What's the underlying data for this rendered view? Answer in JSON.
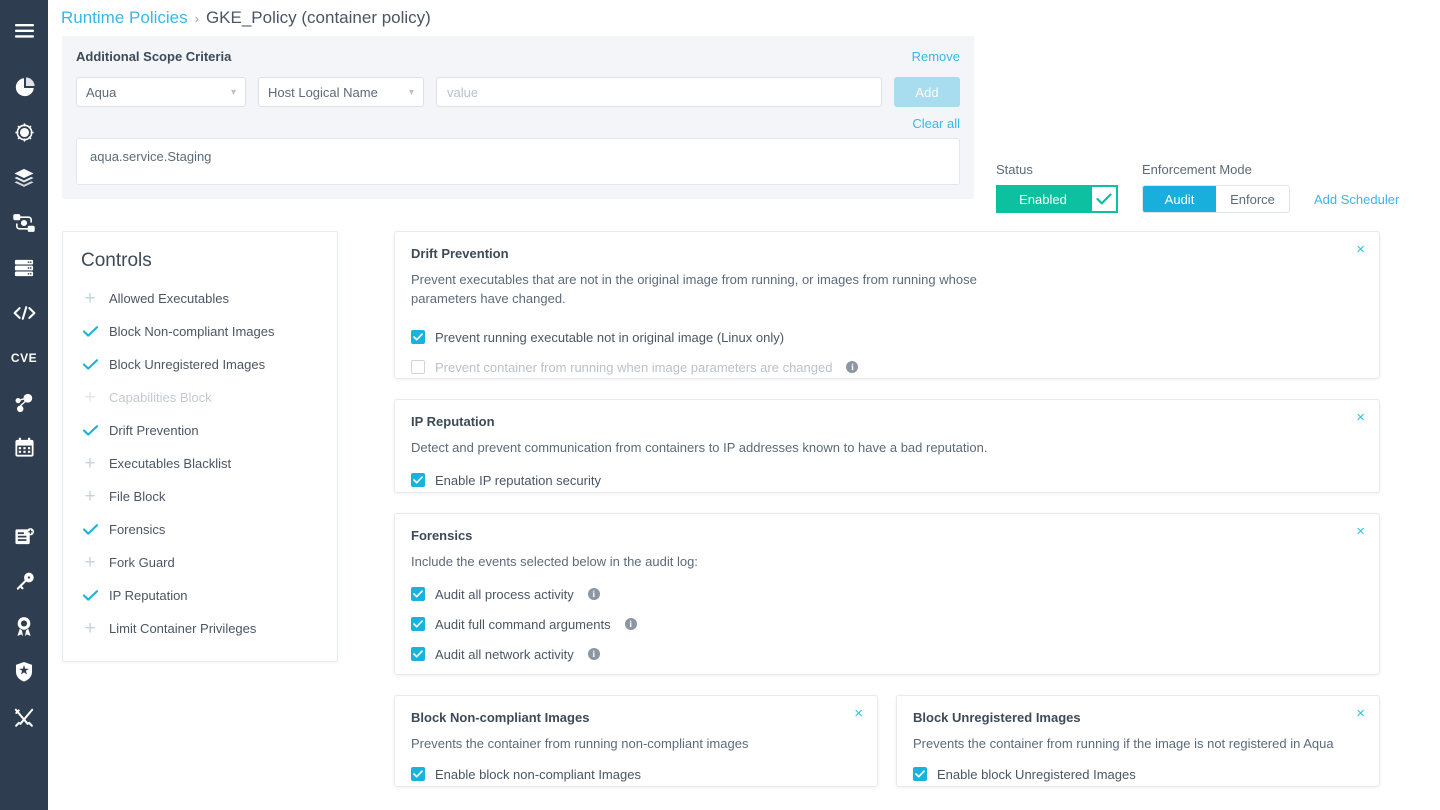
{
  "rail": {
    "items": [
      {
        "name": "hamburger-menu-icon",
        "label": "Menu"
      },
      {
        "name": "dashboard-pie-icon",
        "label": "Dashboard"
      },
      {
        "name": "helm-settings-icon",
        "label": "Workloads"
      },
      {
        "name": "layers-icon",
        "label": "Images"
      },
      {
        "name": "pipeline-icon",
        "label": "Pipeline"
      },
      {
        "name": "server-icon",
        "label": "Infrastructure"
      },
      {
        "name": "code-icon",
        "label": "Code"
      },
      {
        "name": "cve-icon",
        "label": "CVE"
      },
      {
        "name": "topology-icon",
        "label": "Topology"
      },
      {
        "name": "calendar-icon",
        "label": "Scheduler"
      },
      {
        "name": "report-icon",
        "label": "Reports"
      },
      {
        "name": "key-icon",
        "label": "Secrets"
      },
      {
        "name": "badge-icon",
        "label": "Compliance"
      },
      {
        "name": "shield-star-icon",
        "label": "Policies"
      },
      {
        "name": "tools-icon",
        "label": "Administration"
      }
    ],
    "cve_text": "CVE"
  },
  "breadcrumb": {
    "parent": "Runtime Policies",
    "separator": "›",
    "current": "GKE_Policy (container policy)"
  },
  "scope": {
    "title": "Additional Scope Criteria",
    "remove_label": "Remove",
    "clear_all_label": "Clear all",
    "source_select": "Aqua",
    "attribute_select": "Host Logical Name",
    "value_placeholder": "value",
    "value_text": "",
    "add_label": "Add",
    "tag_value": "aqua.service.Staging"
  },
  "status": {
    "status_label": "Status",
    "enabled_label": "Enabled",
    "enforcement_label": "Enforcement Mode",
    "audit_label": "Audit",
    "enforce_label": "Enforce",
    "active_mode": "Audit",
    "add_scheduler_label": "Add Scheduler"
  },
  "controls": {
    "title": "Controls",
    "items": [
      {
        "label": "Allowed Executables",
        "state": "plus",
        "dim": false
      },
      {
        "label": "Block Non-compliant Images",
        "state": "check",
        "dim": false
      },
      {
        "label": "Block Unregistered Images",
        "state": "check",
        "dim": false
      },
      {
        "label": "Capabilities Block",
        "state": "plus",
        "dim": true
      },
      {
        "label": "Drift Prevention",
        "state": "check",
        "dim": false
      },
      {
        "label": "Executables Blacklist",
        "state": "plus",
        "dim": false
      },
      {
        "label": "File Block",
        "state": "plus",
        "dim": false
      },
      {
        "label": "Forensics",
        "state": "check",
        "dim": false
      },
      {
        "label": "Fork Guard",
        "state": "plus",
        "dim": false
      },
      {
        "label": "IP Reputation",
        "state": "check",
        "dim": false
      },
      {
        "label": "Limit Container Privileges",
        "state": "plus",
        "dim": false
      }
    ]
  },
  "cards": {
    "drift": {
      "title": "Drift Prevention",
      "desc": "Prevent executables that are not in the original image from running, or images from running whose parameters have changed.",
      "close": "×",
      "opt1": "Prevent running executable not in original image (Linux only)",
      "opt2": "Prevent container from running when image parameters are changed",
      "info": "i"
    },
    "ip": {
      "title": "IP Reputation",
      "desc": "Detect and prevent communication from containers to IP addresses known to have a bad reputation.",
      "close": "×",
      "opt1": "Enable IP reputation security"
    },
    "forensics": {
      "title": "Forensics",
      "desc": "Include the events selected below in the audit log:",
      "close": "×",
      "opt1": "Audit all process activity",
      "opt2": "Audit full command arguments",
      "opt3": "Audit all network activity",
      "info": "i"
    },
    "noncompliant": {
      "title": "Block Non-compliant Images",
      "desc": "Prevents the container from running non-compliant images",
      "close": "×",
      "opt1": "Enable block non-compliant Images"
    },
    "unregistered": {
      "title": "Block Unregistered Images",
      "desc": "Prevents the container from running if the image is not registered in Aqua",
      "close": "×",
      "opt1": "Enable block Unregistered Images"
    }
  },
  "colors": {
    "rail_bg": "#2e3e50",
    "link": "#35b9e6",
    "checkbox_on": "#17b3dd",
    "enabled_green": "#0cc0a0",
    "segment_active": "#18afdc",
    "panel_bg": "#f3f5f9"
  }
}
